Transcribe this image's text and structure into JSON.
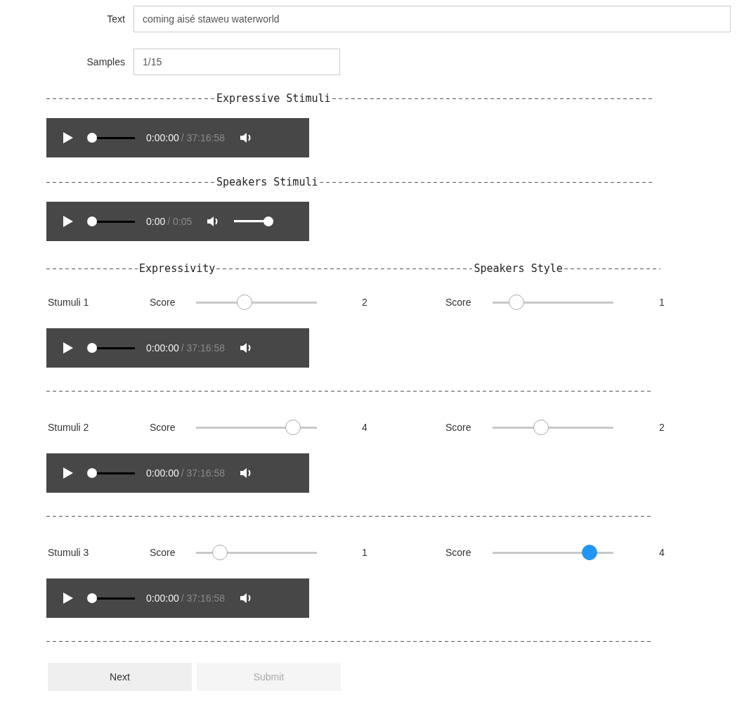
{
  "fields": [
    {
      "label": "Text",
      "value": "coming aisé staweu waterworld",
      "wide": true
    },
    {
      "label": "Samples",
      "value": "1/15",
      "wide": false
    }
  ],
  "expressive": {
    "heading": "Expressive Stimuli",
    "player": {
      "current": "0:00:00",
      "duration": "/ 37:16:58",
      "progress": {
        "level": 0
      }
    }
  },
  "speakers": {
    "heading": "Speakers Stimuli",
    "player": {
      "current": "0:00",
      "duration": "/ 0:05",
      "progress": {
        "level": 0
      },
      "volume": {
        "level": 1
      }
    }
  },
  "rating_headings": [
    "Expressivity",
    "Speakers Style"
  ],
  "stimuli": [
    {
      "label": "Stumuli 1",
      "expressivity": {
        "label": "Score",
        "level": 0.4,
        "value": "2",
        "focused": false
      },
      "style": {
        "label": "Score",
        "level": 0.2,
        "value": "1",
        "focused": false
      },
      "player": {
        "current": "0:00:00",
        "duration": "/ 37:16:58",
        "progress": {
          "level": 0
        }
      }
    },
    {
      "label": "Stumuli 2",
      "expressivity": {
        "label": "Score",
        "level": 0.8,
        "value": "4",
        "focused": false
      },
      "style": {
        "label": "Score",
        "level": 0.4,
        "value": "2",
        "focused": false
      },
      "player": {
        "current": "0:00:00",
        "duration": "/ 37:16:58",
        "progress": {
          "level": 0
        }
      }
    },
    {
      "label": "Stumuli 3",
      "expressivity": {
        "label": "Score",
        "level": 0.2,
        "value": "1",
        "focused": false
      },
      "style": {
        "label": "Score",
        "level": 0.8,
        "value": "4",
        "focused": true
      },
      "player": {
        "current": "0:00:00",
        "duration": "/ 37:16:58",
        "progress": {
          "level": 0
        }
      }
    }
  ],
  "buttons": [
    {
      "label": "Next",
      "disabled": false
    },
    {
      "label": "Submit",
      "disabled": true
    }
  ]
}
